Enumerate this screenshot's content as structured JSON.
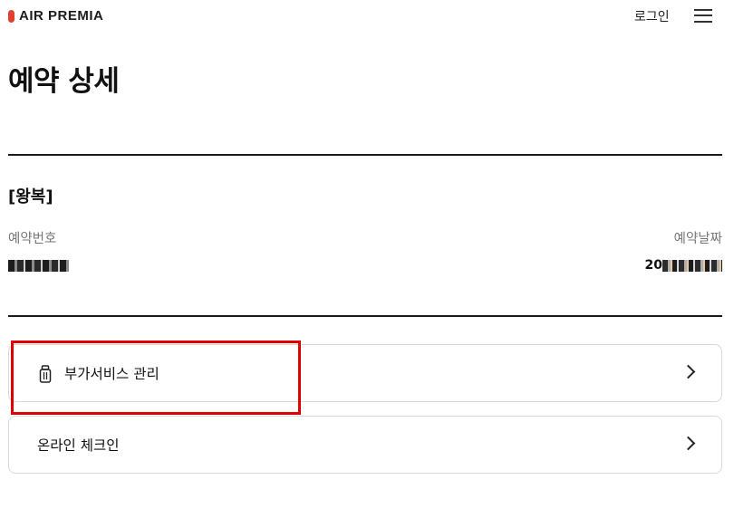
{
  "header": {
    "logo_text": "AIR PREMIA",
    "login_label": "로그인",
    "menu_icon": "hamburger-icon"
  },
  "page": {
    "title": "예약 상세"
  },
  "booking": {
    "trip_type": "[왕복]",
    "reservation_number_label": "예약번호",
    "reservation_date_label": "예약날짜",
    "reservation_date_prefix": "20"
  },
  "actions": [
    {
      "label": "부가서비스 관리",
      "icon": "luggage-icon"
    },
    {
      "label": "온라인 체크인"
    }
  ],
  "colors": {
    "brand": "#e0402e",
    "highlight": "#e00000"
  }
}
